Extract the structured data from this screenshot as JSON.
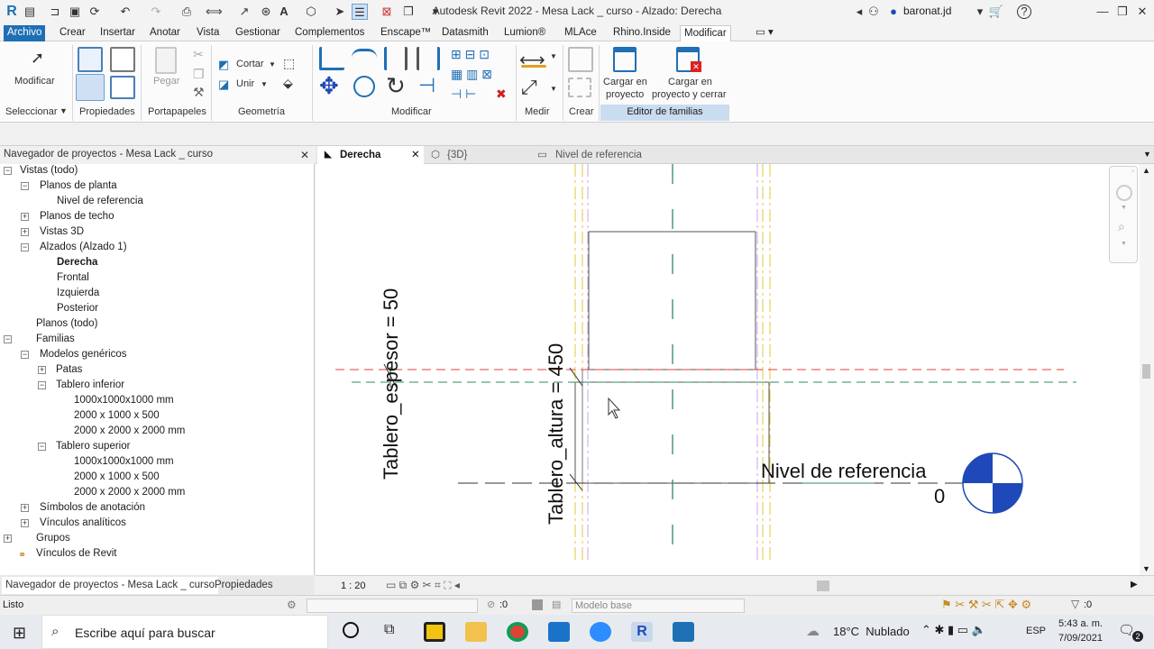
{
  "titlebar": {
    "title": "Autodesk Revit 2022 - Mesa Lack _ curso - Alzado: Derecha",
    "user": "baronat.jd",
    "help": "?"
  },
  "ribbon_tabs": [
    "Archivo",
    "Crear",
    "Insertar",
    "Anotar",
    "Vista",
    "Gestionar",
    "Complementos",
    "Enscape™",
    "Datasmith",
    "Lumion®",
    "MLAce",
    "Rhino.Inside",
    "Modificar"
  ],
  "ribbon": {
    "modificar_label": "Modificar",
    "pegar_label": "Pegar",
    "cortar_label": "Cortar",
    "unir_label": "Unir",
    "cargar_proyecto_l1": "Cargar en",
    "cargar_proyecto_l2": "proyecto",
    "cargar_cerrar_l1": "Cargar en",
    "cargar_cerrar_l2": "proyecto y cerrar",
    "panels": {
      "seleccionar": "Seleccionar",
      "propiedades": "Propiedades",
      "portapapeles": "Portapapeles",
      "geometria": "Geometría",
      "modificar": "Modificar",
      "medir": "Medir",
      "crear": "Crear",
      "editor": "Editor de familias"
    }
  },
  "browser": {
    "header": "Navegador de proyectos - Mesa Lack _ curso",
    "close": "✕",
    "items": [
      {
        "label": "Vistas (todo)"
      },
      {
        "label": "Planos de planta"
      },
      {
        "label": "Nivel de referencia"
      },
      {
        "label": "Planos de techo"
      },
      {
        "label": "Vistas 3D"
      },
      {
        "label": "Alzados (Alzado 1)"
      },
      {
        "label": "Derecha"
      },
      {
        "label": "Frontal"
      },
      {
        "label": "Izquierda"
      },
      {
        "label": "Posterior"
      },
      {
        "label": "Planos (todo)"
      },
      {
        "label": "Familias"
      },
      {
        "label": "Modelos genéricos"
      },
      {
        "label": "Patas"
      },
      {
        "label": "Tablero inferior"
      },
      {
        "label": "1000x1000x1000 mm"
      },
      {
        "label": "2000 x 1000 x 500"
      },
      {
        "label": "2000 x 2000 x 2000 mm"
      },
      {
        "label": "Tablero superior"
      },
      {
        "label": "1000x1000x1000 mm"
      },
      {
        "label": "2000 x 1000 x 500"
      },
      {
        "label": "2000 x 2000 x 2000 mm"
      },
      {
        "label": "Símbolos de anotación"
      },
      {
        "label": "Vínculos analíticos"
      },
      {
        "label": "Grupos"
      },
      {
        "label": "Vínculos de Revit"
      }
    ],
    "tabs": [
      "Navegador de proyectos - Mesa Lack _ curso",
      "Propiedades"
    ]
  },
  "view_tabs": [
    {
      "label": "Derecha",
      "close": "✕"
    },
    {
      "label": "{3D}"
    },
    {
      "label": "Nivel de referencia"
    }
  ],
  "canvas": {
    "dim_espesor": "Tablero_espesor = 50",
    "dim_altura": "Tablero_altura = 450",
    "level_name": "Nivel de referencia",
    "level_value": "0"
  },
  "view_control": {
    "scale": "1 : 20"
  },
  "statusbar": {
    "status": "Listo",
    "zero1": ":0",
    "model": "Modelo base",
    "zero2": ":0"
  },
  "taskbar": {
    "search_placeholder": "Escribe aquí para buscar",
    "weather": "18°C  Nublado",
    "lang": "ESP",
    "time": "5:43 a. m.",
    "date": "7/09/2021",
    "notif": "2"
  },
  "colors": {
    "file_tab": "#1f6fb5",
    "editor_band": "#c9dcf0",
    "level_blue": "#1f48b8",
    "dashed_red": "#e0403a",
    "dashed_green": "#2f8a62",
    "dashed_yellow": "#e6c53a"
  }
}
